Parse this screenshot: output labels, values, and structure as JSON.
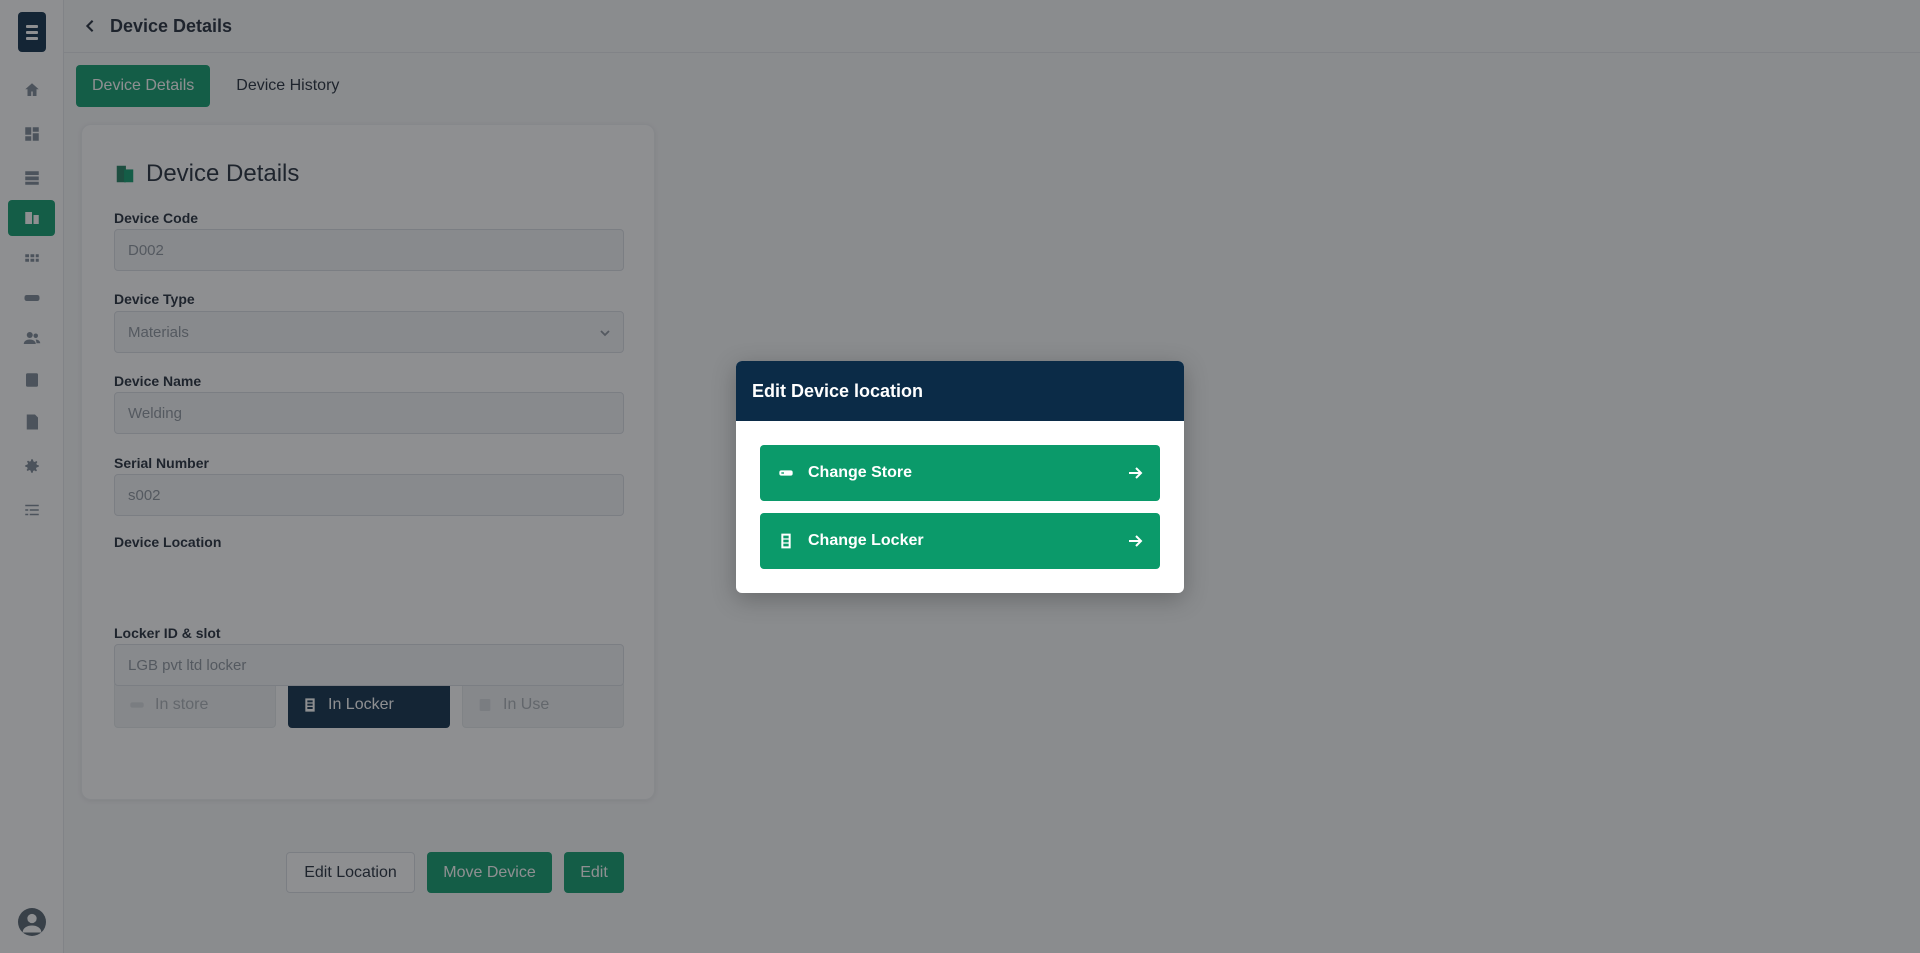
{
  "header": {
    "title": "Device Details"
  },
  "sidebar": {
    "items": [
      {
        "icon": "home-icon",
        "active": false
      },
      {
        "icon": "dashboard-icon",
        "active": false
      },
      {
        "icon": "storage-icon",
        "active": false
      },
      {
        "icon": "devices-icon",
        "active": true
      },
      {
        "icon": "grid-icon",
        "active": false
      },
      {
        "icon": "store-icon",
        "active": false
      },
      {
        "icon": "users-icon",
        "active": false
      },
      {
        "icon": "locker-icon",
        "active": false
      },
      {
        "icon": "report-icon",
        "active": false
      },
      {
        "icon": "settings-icon",
        "active": false
      },
      {
        "icon": "list-icon",
        "active": false
      }
    ]
  },
  "tabs": [
    {
      "label": "Device Details",
      "active": true
    },
    {
      "label": "Device History",
      "active": false
    }
  ],
  "card": {
    "title": "Device Details",
    "fields": {
      "device_code": {
        "label": "Device Code",
        "value": "D002"
      },
      "device_type": {
        "label": "Device Type",
        "value": "Materials"
      },
      "device_name": {
        "label": "Device Name",
        "value": "Welding"
      },
      "serial_number": {
        "label": "Serial Number",
        "value": "s002"
      },
      "device_location": {
        "label": "Device Location"
      },
      "locker_id": {
        "label": "Locker ID & slot",
        "value": "LGB pvt ltd locker"
      }
    },
    "location_options": [
      {
        "label": "In store",
        "selected": false
      },
      {
        "label": "In Locker",
        "selected": true
      },
      {
        "label": "In Use",
        "selected": false
      }
    ],
    "buttons": {
      "edit_location": "Edit Location",
      "move_device": "Move Device",
      "edit": "Edit"
    }
  },
  "modal": {
    "title": "Edit Device location",
    "options": [
      {
        "label": "Change Store",
        "icon": "store-icon"
      },
      {
        "label": "Change Locker",
        "icon": "locker-icon"
      }
    ]
  },
  "colors": {
    "primary_green": "#0b9a6a",
    "navy": "#0b2b47"
  }
}
